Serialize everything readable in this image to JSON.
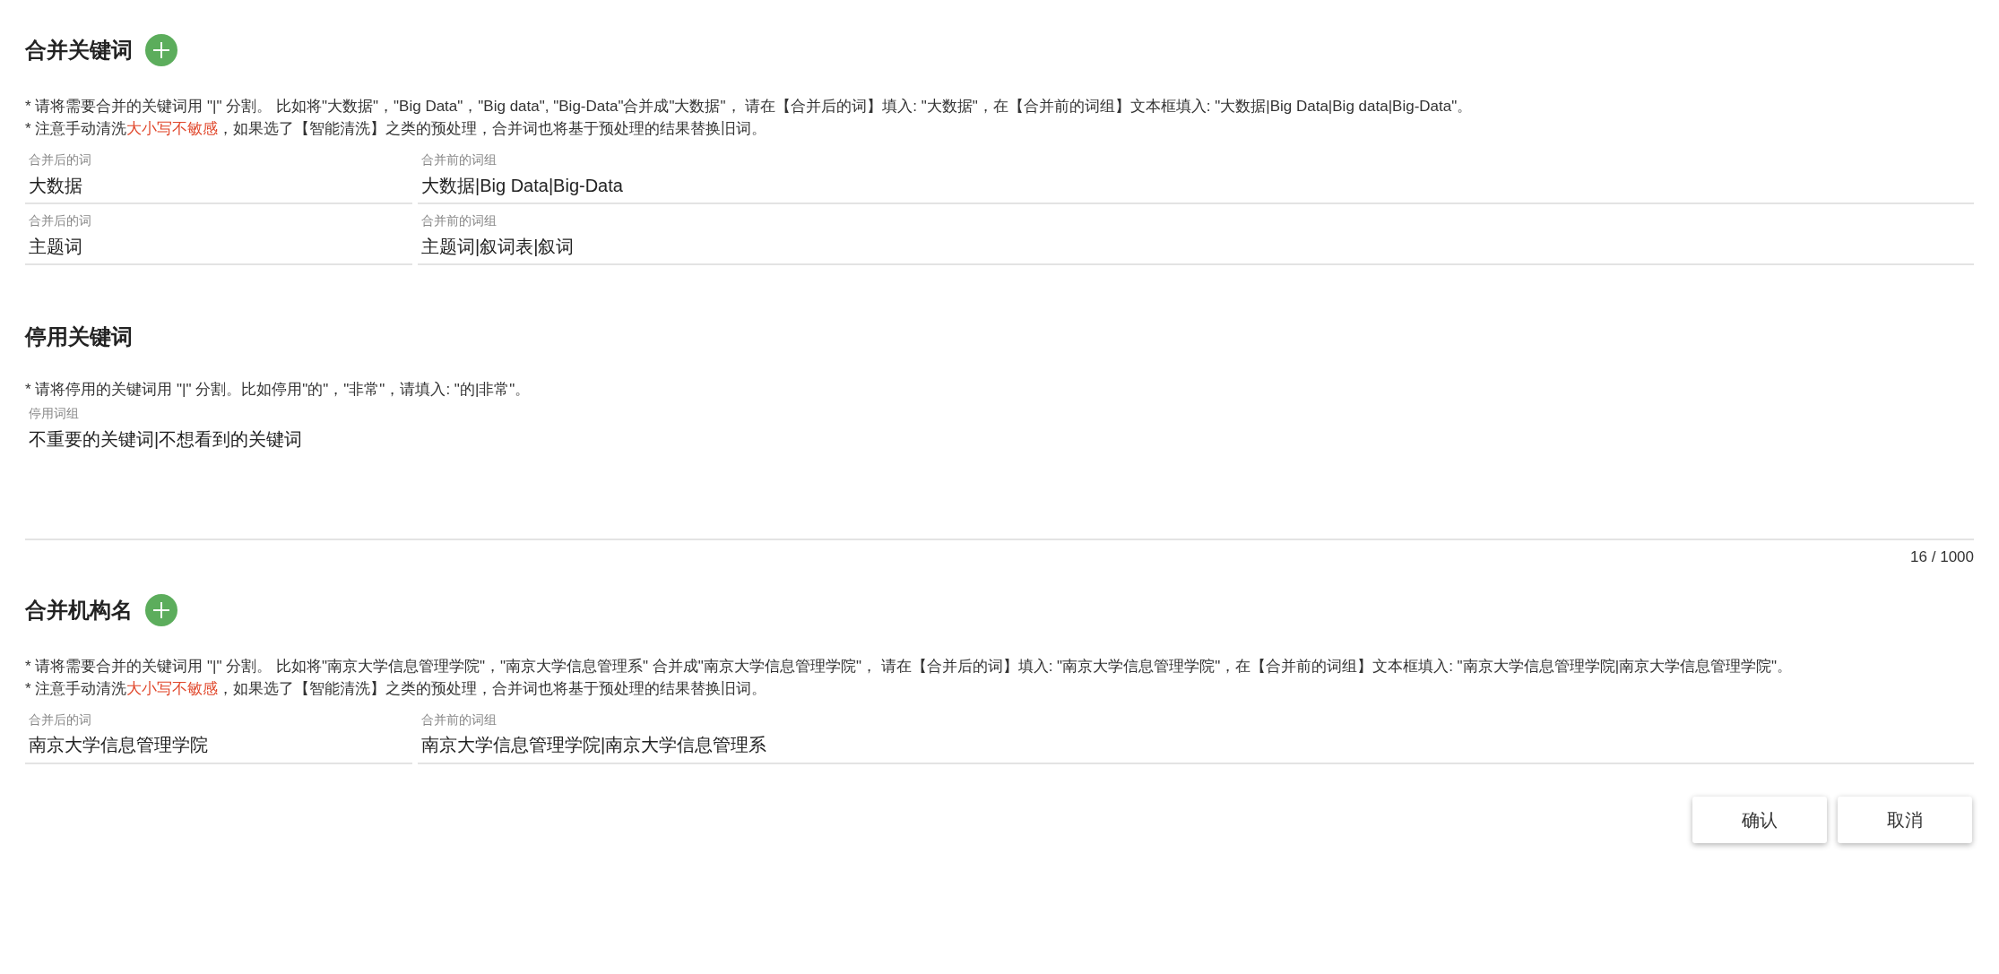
{
  "sections": [
    {
      "kind": "merge",
      "title": "合并关键词",
      "notes": [
        {
          "kind": "plain",
          "text": "* 请将需要合并的关键词用 \"|\" 分割。 比如将\"大数据\"，\"Big Data\"，\"Big data\", \"Big-Data\"合并成\"大数据\"， 请在【合并后的词】填入: \"大数据\"，在【合并前的词组】文本框填入: \"大数据|Big Data|Big data|Big-Data\"。"
        },
        {
          "kind": "warning",
          "before": "* 注意手动清洗",
          "highlight": "大小写不敏感",
          "after": "，如果选了【智能清洗】之类的预处理，合并词也将基于预处理的结果替换旧词。"
        }
      ],
      "rows": [
        {
          "after_label": "合并后的词",
          "after_value": "大数据",
          "before_label": "合并前的词组",
          "before_value": "大数据|Big Data|Big-Data"
        },
        {
          "after_label": "合并后的词",
          "after_value": "主题词",
          "before_label": "合并前的词组",
          "before_value": "主题词|叙词表|叙词"
        }
      ]
    },
    {
      "kind": "stop",
      "title": "停用关键词",
      "notes": [
        {
          "kind": "plain",
          "text": "* 请将停用的关键词用 \"|\" 分割。比如停用\"的\"，\"非常\"，请填入: \"的|非常\"。"
        }
      ],
      "field": {
        "label": "停用词组",
        "value": "不重要的关键词|不想看到的关键词",
        "counter": "16 / 1000"
      }
    },
    {
      "kind": "merge",
      "title": "合并机构名",
      "notes": [
        {
          "kind": "plain",
          "text": "* 请将需要合并的关键词用 \"|\" 分割。 比如将\"南京大学信息管理学院\"，\"南京大学信息管理系\" 合并成\"南京大学信息管理学院\"， 请在【合并后的词】填入: \"南京大学信息管理学院\"，在【合并前的词组】文本框填入: \"南京大学信息管理学院|南京大学信息管理学院\"。"
        },
        {
          "kind": "warning",
          "before": "* 注意手动清洗",
          "highlight": "大小写不敏感",
          "after": "，如果选了【智能清洗】之类的预处理，合并词也将基于预处理的结果替换旧词。"
        }
      ],
      "rows": [
        {
          "after_label": "合并后的词",
          "after_value": "南京大学信息管理学院",
          "before_label": "合并前的词组",
          "before_value": "南京大学信息管理学院|南京大学信息管理系"
        }
      ]
    }
  ],
  "buttons": [
    {
      "label": "确认"
    },
    {
      "label": "取消"
    }
  ]
}
